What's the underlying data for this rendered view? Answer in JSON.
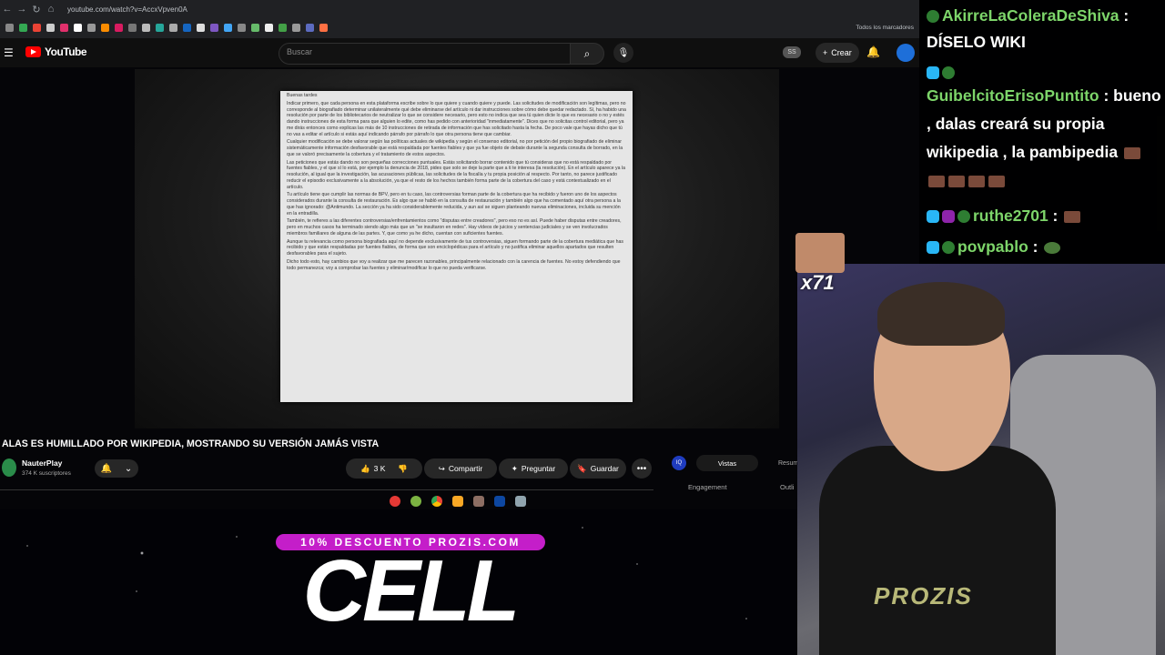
{
  "browser": {
    "url": "youtube.com/watch?v=AccxVpven0A",
    "bookmarks_folder": "Todos los marcadores",
    "icons": [
      "back-icon",
      "forward-icon",
      "reload-icon",
      "home-icon"
    ]
  },
  "youtube": {
    "logo_text": "YouTube",
    "search_placeholder": "Buscar",
    "ss_badge": "SS",
    "create_label": "Crear"
  },
  "document": {
    "paragraphs": [
      "Buenas tardes",
      "Indicar primero, que cada persona en esta plataforma escribe sobre lo que quiere y cuando quiere y puede. Las solicitudes de modificación son legítimas, pero no corresponde al biografiado determinar unilateralmente qué debe eliminarse del artículo ni dar instrucciones sobre cómo debe quedar redactado. Sí, ha habido una resolución por parte de los bibliotecarios de neutralizar lo que se considere necesario, pero esto no indica que sea tú quien dicte lo que es necesario o no y estés dando instrucciones de esta forma para que alguien lo edite, como has pedido con anterioridad \"inmediatamente\". Dices que no solicitas control editorial, pero ya me dirás entonces como explicas las más de 10 instrucciones de retirada de información que has solicitado hasta la fecha. De poco vale que hayas dicho que tú no vas a editar el artículo si estás aquí indicando párrafo por párrafo lo que otra persona tiene que cambiar.",
      "Cualquier modificación se debe valorar según las políticas actuales de wikipedia y según el consenso editorial, no por petición del propio biografiado de eliminar sistemáticamente información desfavorable que está respaldada por fuentes fiables y que ya fue objeto de debate durante la segunda consulta de borrado, en la que se valoró precisamente la cobertura y el tratamiento de estos aspectos.",
      "Las peticiones que estás dando no son pequeñas correcciones puntuales. Estás solicitando borrar contenido que tú consideras que no está respaldado por fuentes fiables, y el que sí lo está, por ejemplo la denuncia de 2018, pides que solo se deje la parte que a ti te interesa (la resolución). En el artículo aparece ya la resolución, al igual que la investigación, las acusaciones públicas, las solicitudes de la fiscalía y tu propia posición al respecto. Por tanto, no parece justificado reducir el episodio exclusivamente a la absolución, ya que el resto de los hechos también forma parte de la cobertura del caso y está contextualizado en el artículo.",
      "Tu artículo tiene que cumplir las normas de BPV, pero en tu caso, las controversias forman parte de la cobertura que ha recibido y fueron uno de los aspectos considerados durante la consulta de restauración. Es algo que se habló en la consulta de restauración y también algo que ha comentado aquí otra persona a la que has ignorado: @Antimundo. La sección ya ha sido considerablemente reducida, y aun así se siguen planteando nuevas eliminaciones, incluida su mención en la entradilla.",
      "También, te refieres a las diferentes controversias/enfrentamientos como \"disputas entre creadores\", pero eso no es así. Puede haber disputas entre creadores, pero en muchos casos ha terminado siendo algo más que un \"se insultaron en redes\". Hay vídeos de juicios y sentencias judiciales y se ven involucrados miembros familiares de alguna de las partes. Y, que como ya he dicho, cuentan con suficientes fuentes.",
      "Aunque tu relevancia como persona biografiada aquí no depende exclusivamente de tus controversias, siguen formando parte de la cobertura mediática que has recibido y que están respaldadas por fuentes fiables, de forma que son enciclopédicas para el artículo y no justifica eliminar aquellos apartados que resulten desfavorables para el sujeto.",
      "Dicho todo esto, hay cambios que voy a realizar que me parecen razonables, principalmente relacionado con la carencia de fuentes. No estoy defendiendo que todo permanezca; voy a comprobar las fuentes y eliminar/modificar lo que no pueda verificarse."
    ]
  },
  "video": {
    "title": "ALAS ES HUMILLADO POR WIKIPEDIA, MOSTRANDO SU VERSIÓN JAMÁS VISTA",
    "channel_name": "NauterPlay",
    "subscribers": "374 K suscriptores",
    "likes": "3 K",
    "share_label": "Compartir",
    "ask_label": "Preguntar",
    "save_label": "Guardar"
  },
  "side_panel": {
    "iq_label": "IQ",
    "tab_active": "Vistas",
    "tab_other": "Resum",
    "col1": "Engagement",
    "col2": "Outli"
  },
  "promo": {
    "badge": "10% DESCUENTO PROZIS.COM",
    "headline": "CELL"
  },
  "chat": {
    "messages": [
      {
        "user": "AkirreLaColeraDeShiva",
        "sep": " :",
        "text": "DÍSELO WIKI"
      },
      {
        "user": "",
        "sep": "",
        "text": ""
      },
      {
        "user": "GuibelcitoErisoPuntito",
        "sep": " :",
        "text": "bueno , dalas creará su propia wikipedia , la pambipedia"
      },
      {
        "user": "ruthe2701",
        "sep": " :",
        "text": ""
      },
      {
        "user": "povpablo",
        "sep": " :",
        "text": ""
      }
    ]
  },
  "alert": {
    "count": "x71"
  },
  "cam": {
    "shirt_text": "PROZIS"
  }
}
